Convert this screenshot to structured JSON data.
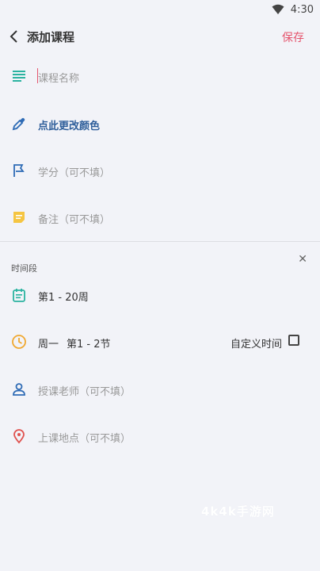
{
  "status": {
    "time": "4:30"
  },
  "header": {
    "title": "添加课程",
    "save_label": "保存"
  },
  "form": {
    "course_name_placeholder": "课程名称",
    "color_label": "点此更改颜色",
    "credit_placeholder": "学分（可不填）",
    "note_placeholder": "备注（可不填）"
  },
  "time_section": {
    "label": "时间段",
    "weeks": "第1 - 20周",
    "day": "周一",
    "periods": "第1 - 2节",
    "custom_time_label": "自定义时间",
    "custom_time_checked": false,
    "teacher_placeholder": "授课老师（可不填）",
    "location_placeholder": "上课地点（可不填）"
  },
  "watermark": "4k4k手游网",
  "colors": {
    "accent": "#e5546d",
    "teal": "#2bb3a0",
    "blue": "#2e6bb5",
    "yellow": "#f5c542",
    "orange": "#f0a830",
    "red": "#e0524f"
  },
  "icons": [
    "wifi-icon",
    "back-arrow-icon",
    "text-lines-icon",
    "dropper-icon",
    "flag-icon",
    "note-icon",
    "calendar-icon",
    "clock-icon",
    "person-icon",
    "location-pin-icon",
    "close-icon"
  ]
}
